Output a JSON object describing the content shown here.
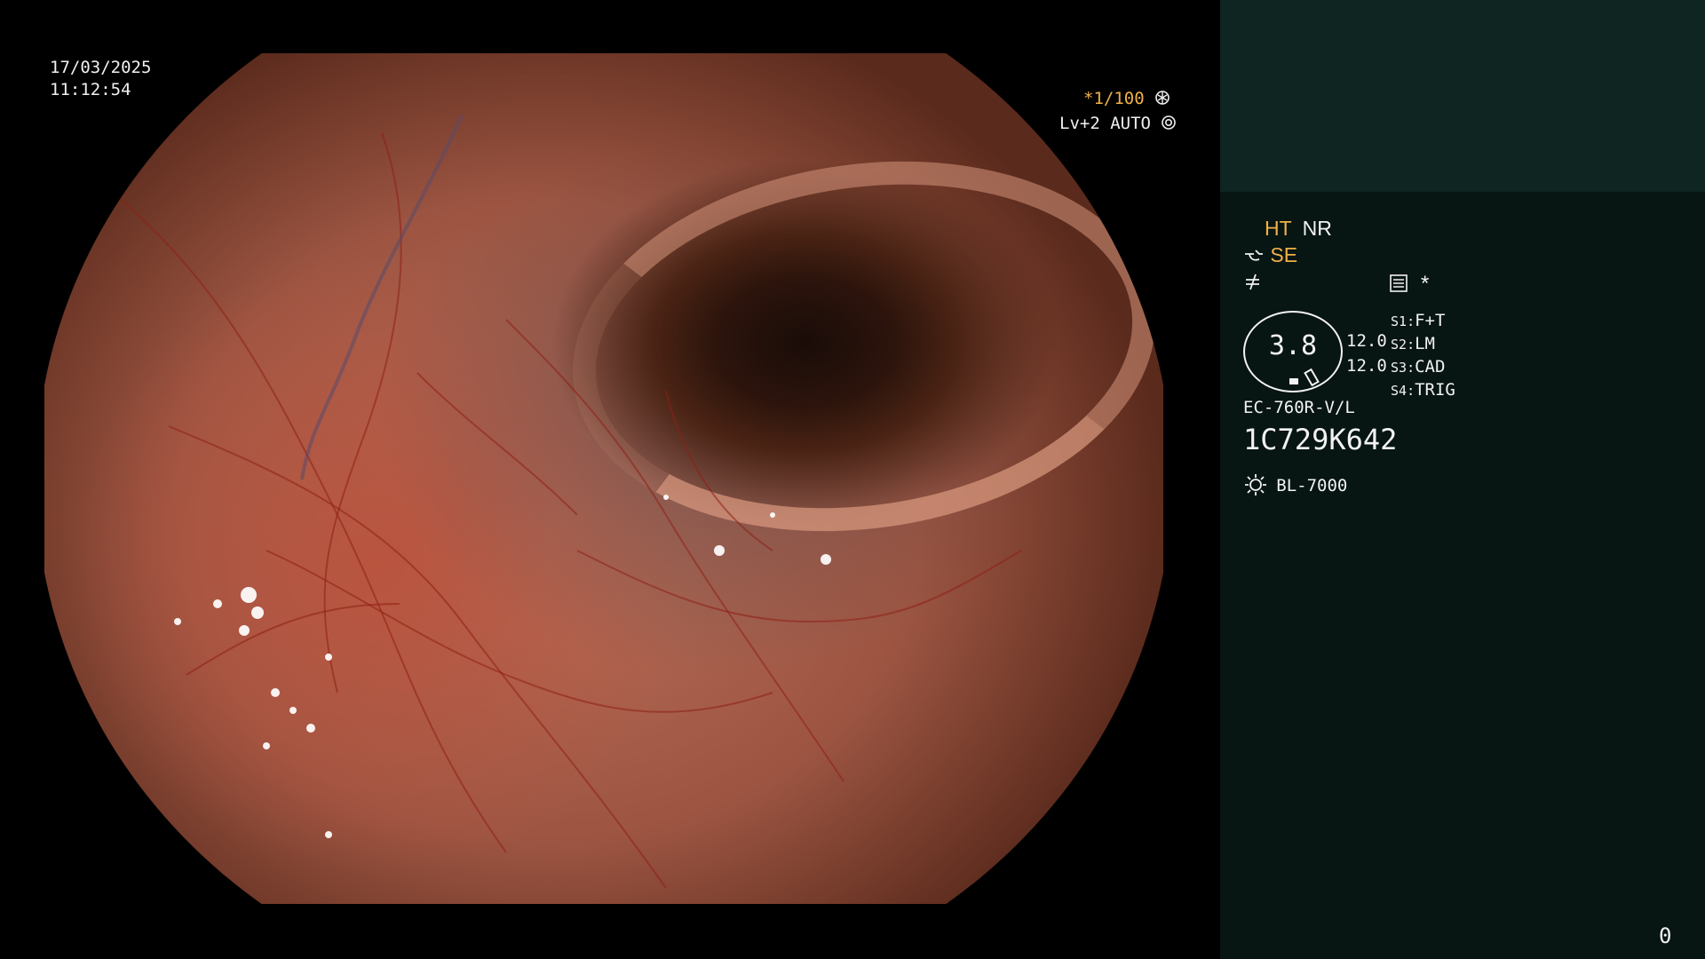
{
  "overlay": {
    "date": "17/03/2025",
    "time": "11:12:54",
    "shutter": "*1/100",
    "shutter_icon": "shutter-icon",
    "level": "Lv+2 AUTO",
    "auto_icon": "auto-iris-icon"
  },
  "panel": {
    "ht": "HT",
    "nr": "NR",
    "se": "SE",
    "se_icon": "enhance-curve-icon",
    "mode_icon": "freeze-slash-icon",
    "settings_icon": "settings-sheet-icon",
    "star": "*",
    "iris_value": "3.8",
    "gain_1": "12.0",
    "gain_2": "12.0",
    "switches": [
      {
        "key": "S1",
        "value": "F+T"
      },
      {
        "key": "S2",
        "value": "LM"
      },
      {
        "key": "S3",
        "value": "CAD"
      },
      {
        "key": "S4",
        "value": "TRIG"
      }
    ],
    "scope_model": "EC-760R-V/L",
    "serial": "1C729K642",
    "light_icon": "light-source-icon",
    "light_source": "BL-7000",
    "counter": "0"
  },
  "colors": {
    "accent_amber": "#f0b04a",
    "panel_bg": "#071513",
    "panel_top_band": "#0e2522"
  }
}
